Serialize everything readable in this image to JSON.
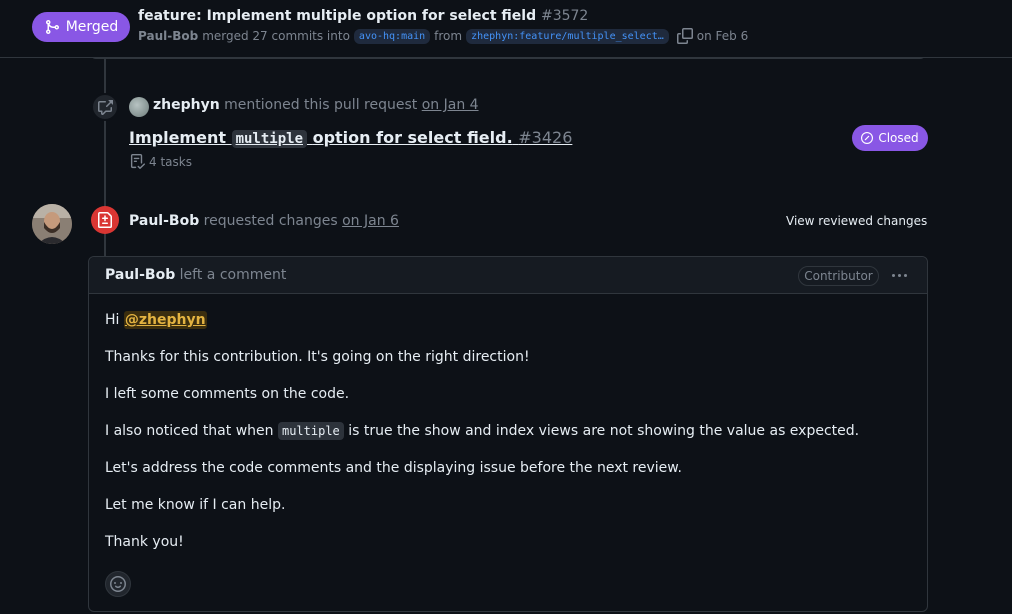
{
  "header": {
    "state": "Merged",
    "title": "feature: Implement multiple option for select field",
    "number": "#3572",
    "author": "Paul-Bob",
    "merged_text": "merged 27 commits into",
    "base_branch": "avo-hq:main",
    "from_text": "from",
    "head_branch": "zhephyn:feature/multiple_select…",
    "date": "on Feb 6"
  },
  "mention_event": {
    "user": "zhephyn",
    "text": "mentioned this pull request",
    "date": "on Jan 4",
    "ref_title_before": "Implement",
    "ref_title_code": "multiple",
    "ref_title_after": "option for select field.",
    "ref_number": "#3426",
    "tasks": "4 tasks",
    "status": "Closed"
  },
  "review_event": {
    "user": "Paul-Bob",
    "text": "requested changes",
    "date": "on Jan 6",
    "view_label": "View reviewed changes"
  },
  "comment": {
    "author": "Paul-Bob",
    "action": "left a comment",
    "role": "Contributor",
    "greeting": "Hi",
    "mention": "@zhephyn",
    "line1": "Thanks for this contribution. It's going on the right direction!",
    "line2": "I left some comments on the code.",
    "line3_before": "I also noticed that when",
    "line3_code": "multiple",
    "line3_after": "is true the show and index views are not showing the value as expected.",
    "line4": "Let's address the code comments and the displaying issue before the next review.",
    "line5": "Let me know if I can help.",
    "line6": "Thank you!"
  },
  "colors": {
    "merged": "#8957e5",
    "requested_changes": "#da3633",
    "link": "#4493f8",
    "mention": "#e3b341"
  }
}
